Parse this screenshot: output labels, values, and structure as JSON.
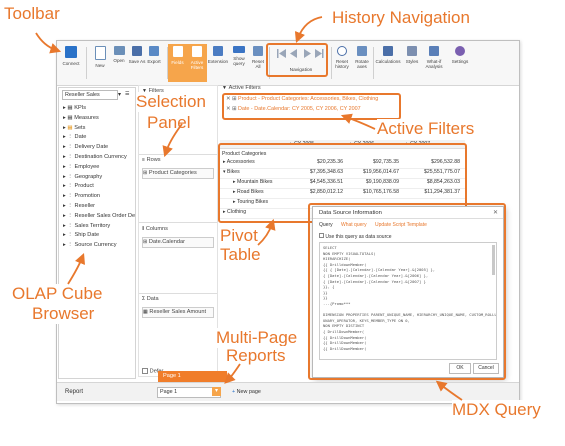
{
  "callouts": {
    "toolbar": "Toolbar",
    "history": "History Navigation",
    "selection_panel_1": "Selection",
    "selection_panel_2": "Panel",
    "active_filters": "Active Filters",
    "pivot_table_1": "Pivot",
    "pivot_table_2": "Table",
    "olap_1": "OLAP Cube",
    "olap_2": "Browser",
    "multipage_1": "Multi-Page",
    "multipage_2": "Reports",
    "mdx": "MDX Query"
  },
  "toolbar": {
    "connect": "Connect",
    "new": "New",
    "open": "Open",
    "save_as": "Save As",
    "export": "Export",
    "fields": "Fields",
    "active_filters": "Active Filters",
    "extension": "Extension",
    "show_query": "Show query",
    "reset_all": "Reset All",
    "navigation": "Navigation",
    "reset_history": "Reset history",
    "rotate_axes": "Rotate axes",
    "calculations": "Calculations",
    "styles": "Styles",
    "what_if": "What-if Analysis",
    "settings": "Settings"
  },
  "cube": {
    "selected": "Reseller Sales",
    "items": [
      "KPIs",
      "Measures",
      "Sets",
      "Date",
      "Delivery Date",
      "Destination Currency",
      "Employee",
      "Geography",
      "Product",
      "Promotion",
      "Reseller",
      "Reseller Sales Order De",
      "Sales Territory",
      "Ship Date",
      "Source Currency"
    ]
  },
  "selection": {
    "filters": "Filters",
    "rows": "Rows",
    "rows_item": "Product Categories",
    "columns": "Columns",
    "columns_item": "Date.Calendar",
    "data": "Data",
    "data_item": "Reseller Sales Amount",
    "defer": "Defer"
  },
  "active_filters": {
    "header": "Active Filters",
    "filter1": "Product - Product Categories: Accessories, Bikes, Clothing",
    "filter2": "Date - Date.Calendar: CY 2005, CY 2006, CY 2007"
  },
  "pivot": {
    "row_header": "Product Categories",
    "col1": "CY 2005",
    "col2": "CY 2006",
    "col3": "CY 2007",
    "rows": [
      {
        "label": "Accessories",
        "v1": "$20,235.36",
        "v2": "$92,735.35",
        "v3": "$296,532.88"
      },
      {
        "label": "Bikes",
        "v1": "$7,395,348.63",
        "v2": "$19,956,014.67",
        "v3": "$25,551,775.07"
      },
      {
        "label": "Mountain Bikes",
        "v1": "$4,545,336.51",
        "v2": "$9,190,838.09",
        "v3": "$8,854,263.03"
      },
      {
        "label": "Road Bikes",
        "v1": "$2,850,012.12",
        "v2": "$10,765,176.58",
        "v3": "$11,294,381.37"
      },
      {
        "label": "Touring Bikes",
        "v1": "",
        "v2": "",
        "v3": ""
      },
      {
        "label": "Clothing",
        "v1": "",
        "v2": "",
        "v3": ""
      }
    ]
  },
  "dialog": {
    "title": "Data Source Information",
    "tab1": "Query",
    "tab2": "What query",
    "tab3": "Update Script Template",
    "checkbox": "Use this query as data source",
    "query_lines": [
      "SELECT",
      "NON EMPTY VISUALTOTALS(",
      "HIERARCHIZE(",
      "{{ DrilldownMember(",
      "{{ { [Date].[Calendar].[Calendar Year].&[2005] },",
      "{ [Date].[Calendar].[Calendar Year].&[2006] },",
      "{ [Date].[Calendar].[Calendar Year].&[2007] }",
      "}}, {",
      "}}",
      "}}",
      "...{Promo***",
      "",
      "DIMENSION PROPERTIES PARENT_UNIQUE_NAME, HIERARCHY_UNIQUE_NAME, CUSTOM_ROLLUP,",
      "UNARY_OPERATOR, KEYS_MEMBER_TYPE ON 0,",
      "NON EMPTY DISTINCT",
      "{ DrillDownMember(",
      "{{ DrillDownMember(",
      "{{ DrillDownMember(",
      "{{ DrillDownMember("
    ],
    "ok": "OK",
    "cancel": "Cancel"
  },
  "report": {
    "label": "Report",
    "page_value": "Page 1",
    "page_option": "Page 1",
    "new_page": "New page"
  }
}
